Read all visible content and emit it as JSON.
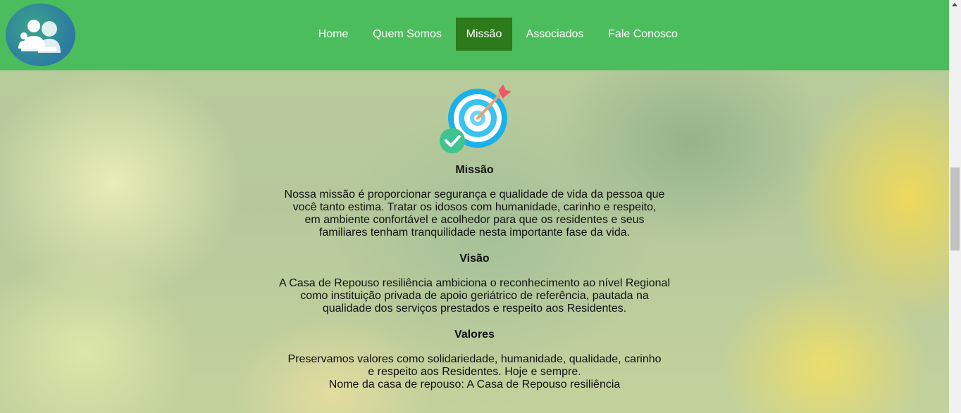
{
  "nav": {
    "items": [
      {
        "label": "Home",
        "active": false
      },
      {
        "label": "Quem Somos",
        "active": false
      },
      {
        "label": "Missão",
        "active": true
      },
      {
        "label": "Associados",
        "active": false
      },
      {
        "label": "Fale Conosco",
        "active": false
      }
    ],
    "background_color": "#4bbd5c",
    "active_color": "#2c7a19"
  },
  "logo": {
    "icon": "family-people-icon"
  },
  "mission_section": {
    "icon": "target-arrow-check-icon",
    "missao": {
      "title": "Missão",
      "lines": [
        "Nossa missão é proporcionar segurança e qualidade de vida da pessoa que",
        "você tanto estima. Tratar os idosos com humanidade, carinho e respeito,",
        "em ambiente confortável e acolhedor para que os residentes e seus",
        "familiares tenham tranquilidade nesta importante fase da vida."
      ]
    },
    "visao": {
      "title": "Visão",
      "lines": [
        "A Casa de Repouso resiliência ambiciona o reconhecimento ao nível Regional",
        "como instituição privada de apoio geriátrico de referência, pautada na",
        "qualidade dos serviços prestados e respeito aos Residentes."
      ]
    },
    "valores": {
      "title": "Valores",
      "lines": [
        "Preservamos valores como solidariedade, humanidade, qualidade, carinho",
        "e respeito aos Residentes. Hoje e sempre.",
        "Nome da casa de repouso: A Casa de Repouso resiliência"
      ]
    }
  }
}
